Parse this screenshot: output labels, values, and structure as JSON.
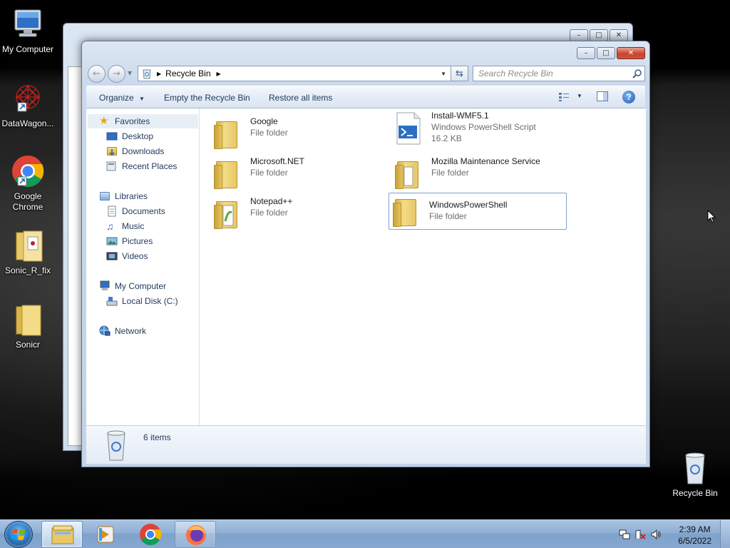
{
  "desktop": {
    "icons": [
      {
        "label": "My Computer"
      },
      {
        "label": "DataWagon..."
      },
      {
        "label": "Google Chrome"
      },
      {
        "label": "Sonic_R_fix"
      },
      {
        "label": "Sonicr"
      },
      {
        "label": "Recycle Bin"
      }
    ]
  },
  "window": {
    "caption_buttons": {
      "minimize": "–",
      "maximize": "□",
      "close": "✕"
    },
    "address": {
      "location": "Recycle Bin"
    },
    "search": {
      "placeholder": "Search Recycle Bin"
    },
    "toolbar": {
      "organize": "Organize",
      "empty": "Empty the Recycle Bin",
      "restore": "Restore all items"
    },
    "navpane": {
      "favorites": "Favorites",
      "desktop": "Desktop",
      "downloads": "Downloads",
      "recent": "Recent Places",
      "libraries": "Libraries",
      "documents": "Documents",
      "music": "Music",
      "pictures": "Pictures",
      "videos": "Videos",
      "computer": "My Computer",
      "localdisk": "Local Disk (C:)",
      "network": "Network"
    },
    "files": [
      {
        "name": "Google",
        "type": "File folder"
      },
      {
        "name": "Install-WMF5.1",
        "type": "Windows PowerShell Script",
        "size": "16.2 KB"
      },
      {
        "name": "Microsoft.NET",
        "type": "File folder"
      },
      {
        "name": "Mozilla Maintenance Service",
        "type": "File folder"
      },
      {
        "name": "Notepad++",
        "type": "File folder"
      },
      {
        "name": "WindowsPowerShell",
        "type": "File folder"
      }
    ],
    "details": {
      "count": "6 items"
    }
  },
  "taskbar": {
    "apps": [
      {
        "icon": "explorer-icon"
      },
      {
        "icon": "media-player-icon"
      },
      {
        "icon": "chrome-icon"
      },
      {
        "icon": "firefox-icon"
      }
    ],
    "clock": {
      "time": "2:39 AM",
      "date": "6/5/2022"
    }
  }
}
